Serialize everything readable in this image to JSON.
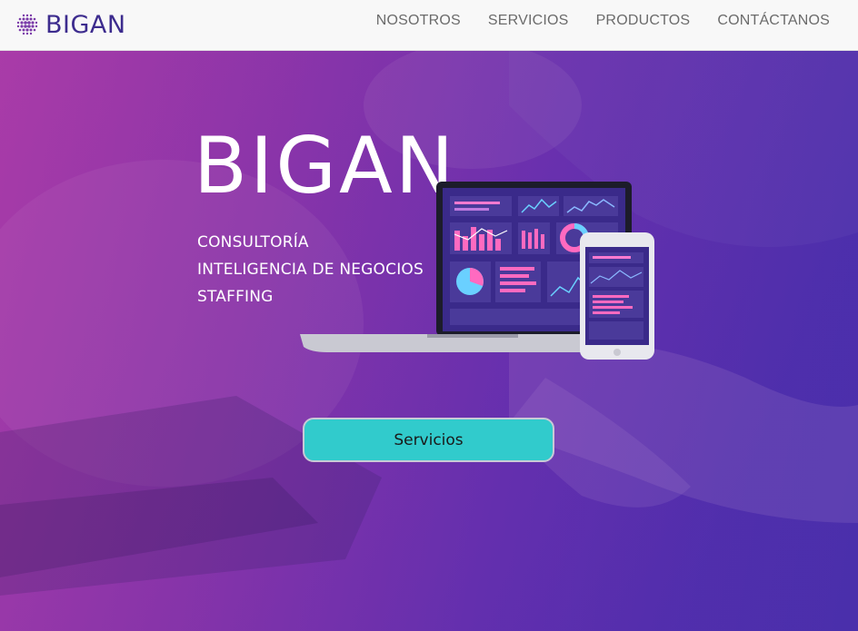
{
  "navbar": {
    "brand": "BIGAN",
    "links": [
      "NOSOTROS",
      "SERVICIOS",
      "PRODUCTOS",
      "CONTÁCTANOS"
    ]
  },
  "hero": {
    "title": "BIGAN",
    "lines": [
      "CONSULTORÍA",
      "INTELIGENCIA DE NEGOCIOS",
      "STAFFING"
    ],
    "button_label": "Servicios"
  },
  "colors": {
    "brand": "#3d2c8e",
    "accent_button": "#31cbcc",
    "hero_gradient_start": "#a33aa8",
    "hero_gradient_end": "#5232a8"
  },
  "icons": [
    "bigan-logo-dots-icon"
  ]
}
